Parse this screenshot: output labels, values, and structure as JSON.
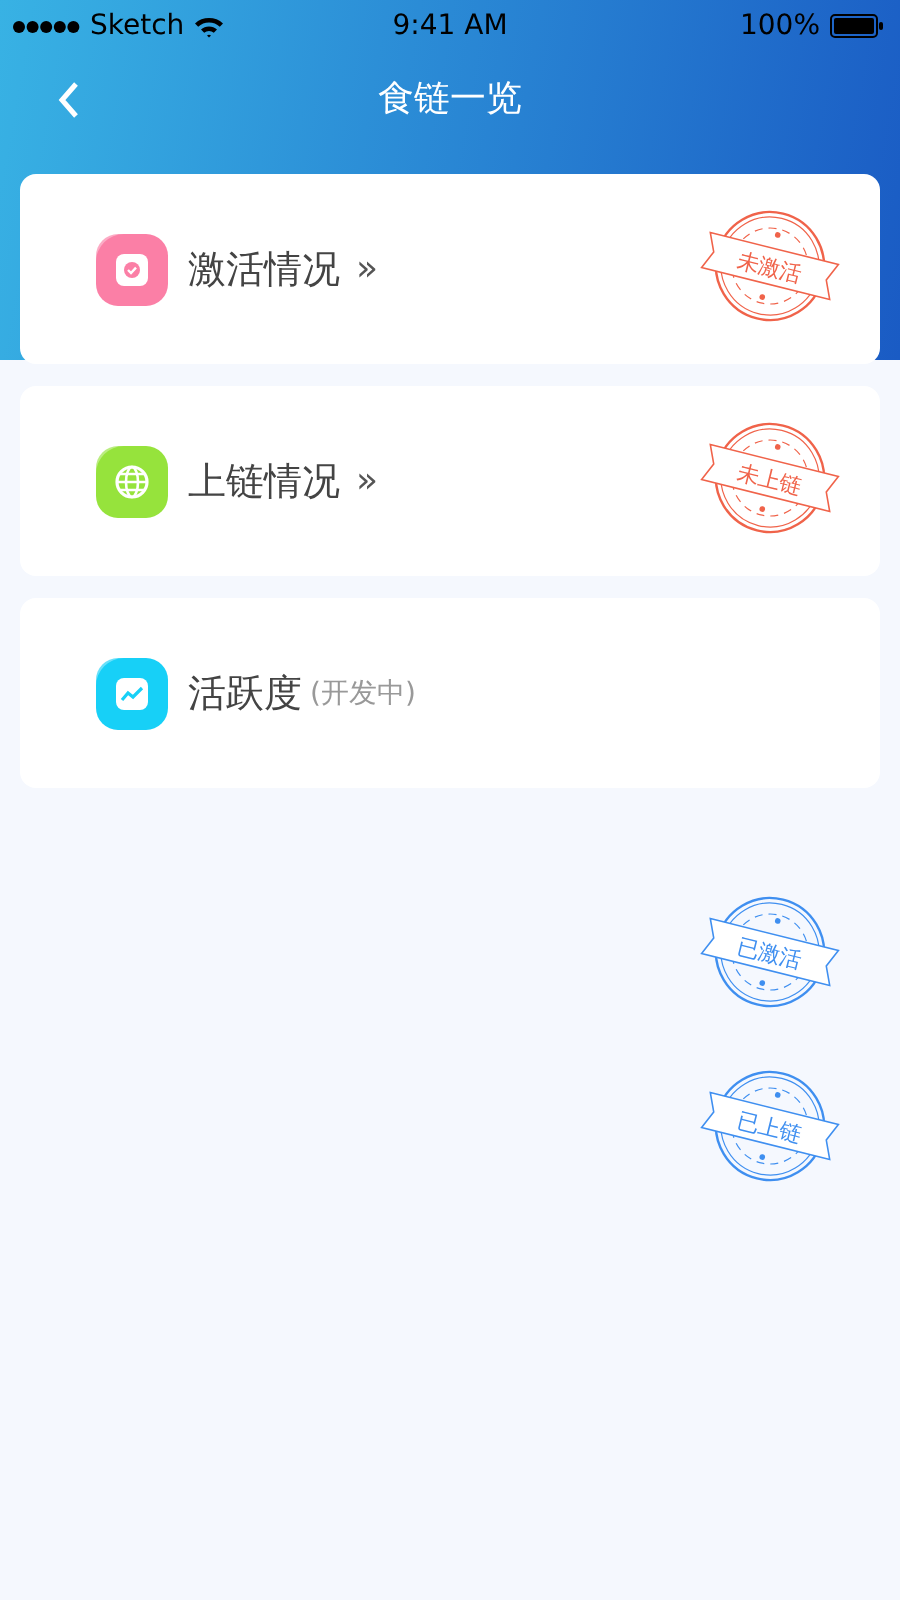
{
  "status_bar": {
    "carrier": "Sketch",
    "time": "9:41 AM",
    "battery": "100%"
  },
  "nav": {
    "title": "食链一览"
  },
  "cards": [
    {
      "kind": "activation",
      "title": "激活情况",
      "arrow": "»",
      "stamp": {
        "text": "未激活",
        "color": "#f0634a"
      }
    },
    {
      "kind": "chain",
      "title": "上链情况",
      "arrow": "»",
      "stamp": {
        "text": "未上链",
        "color": "#f0634a"
      }
    },
    {
      "kind": "activity",
      "title": "活跃度",
      "note": "(开发中)"
    }
  ],
  "stamps": [
    {
      "text": "已激活",
      "color": "#3f8ff0"
    },
    {
      "text": "已上链",
      "color": "#3f8ff0"
    }
  ]
}
